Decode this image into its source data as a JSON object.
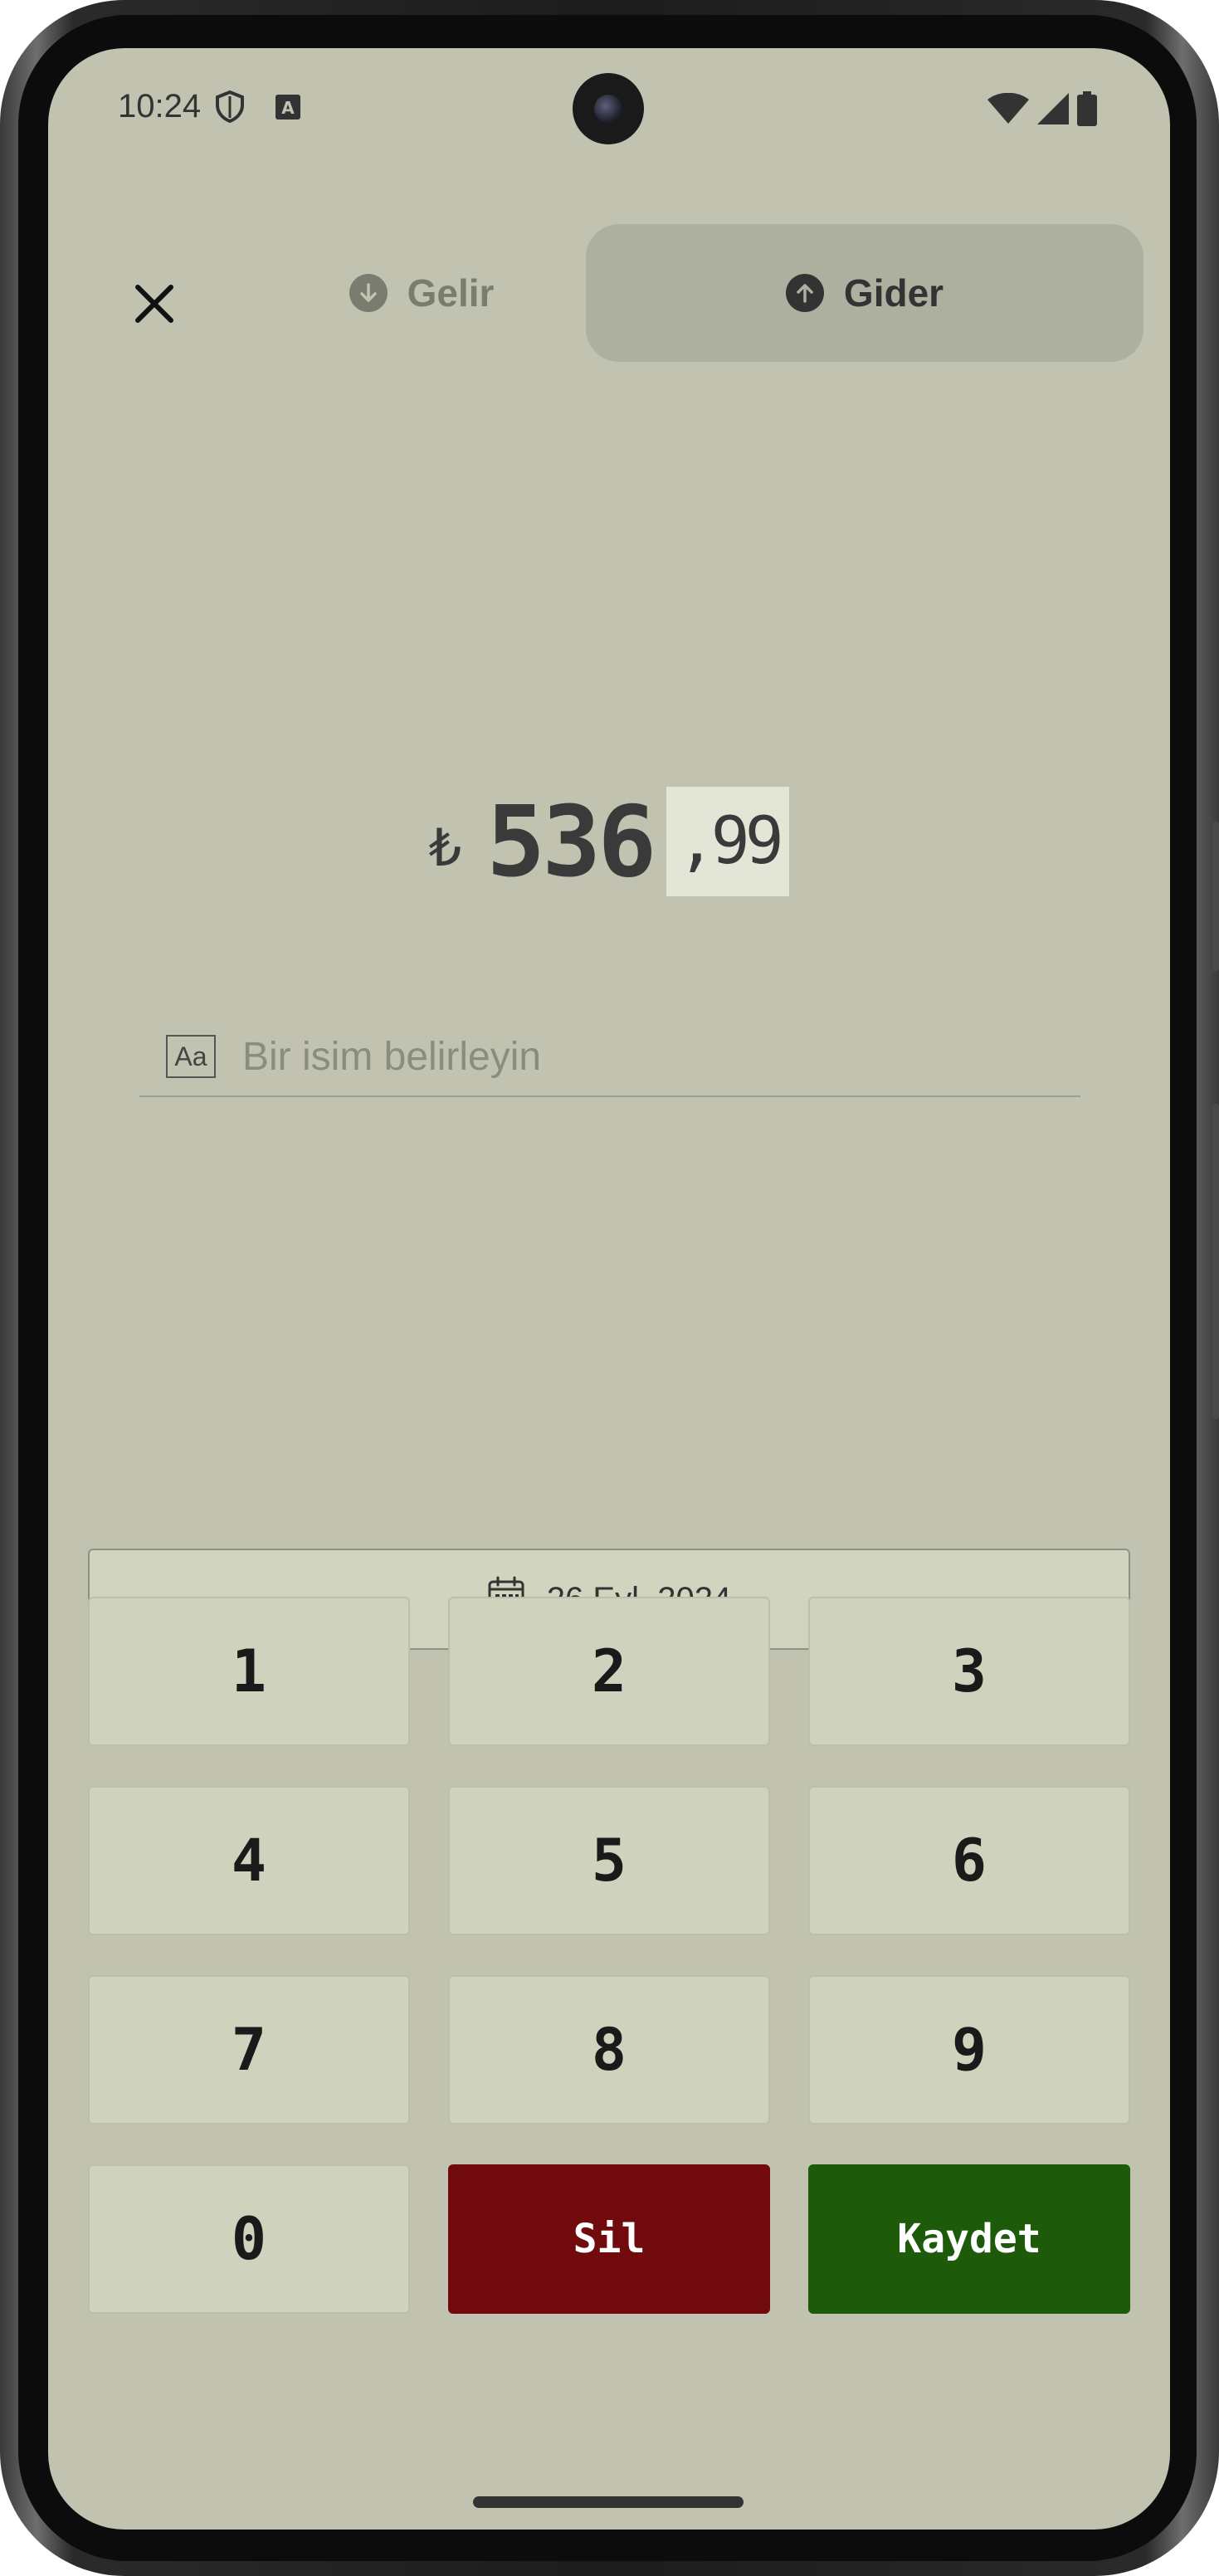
{
  "status_bar": {
    "time": "10:24",
    "icons": [
      "shield-icon",
      "font-badge-icon",
      "wifi-icon",
      "cellular-icon",
      "battery-icon"
    ]
  },
  "header": {
    "close_icon": "close-icon",
    "income_tab_label": "Gelir",
    "expense_tab_label": "Gider",
    "selected_tab": "Gider"
  },
  "amount": {
    "currency": "₺",
    "integer": "536",
    "decimal": ",99"
  },
  "name_field": {
    "icon_label": "Aa",
    "placeholder": "Bir isim belirleyin"
  },
  "date": {
    "label": "26 Eyl, 2024"
  },
  "keypad": {
    "keys": [
      "1",
      "2",
      "3",
      "4",
      "5",
      "6",
      "7",
      "8",
      "9",
      "0"
    ],
    "delete_label": "Sil",
    "save_label": "Kaydet"
  },
  "colors": {
    "background": "#c1c3b0",
    "selected_tab": "#aeb09f",
    "key": "#cfd2bd",
    "delete": "#710a0c",
    "save": "#1d5b0b"
  }
}
